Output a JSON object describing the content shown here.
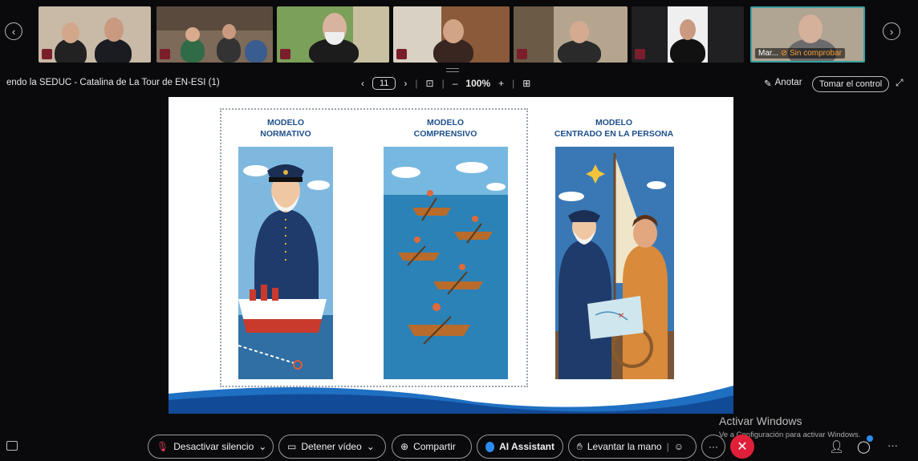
{
  "meeting": {
    "share_title": "endo la SEDUC - Catalina de La Tour de EN-ESI (1)",
    "page_current": "11",
    "zoom": "100%",
    "annotate_label": "Anotar",
    "take_control_label": "Tomar el control",
    "prev_page": "‹",
    "next_page": "›",
    "zoom_out": "–",
    "zoom_in": "+"
  },
  "participants": {
    "active_label": "Mar...",
    "active_status": "Sin comprobar"
  },
  "slide": {
    "col1": [
      "MODELO",
      "NORMATIVO"
    ],
    "col2": [
      "MODELO",
      "COMPRENSIVO"
    ],
    "col3": [
      "MODELO",
      "CENTRADO EN LA PERSONA"
    ]
  },
  "toolbar": {
    "mute_label": "Desactivar silencio",
    "video_label": "Detener vídeo",
    "share_label": "Compartir",
    "ai_label": "AI Assistant",
    "hand_label": "Levantar la mano",
    "more_label": "···"
  },
  "windows": {
    "activate_title": "Activar Windows",
    "activate_sub": "Ve a Configuración para activar Windows."
  },
  "icons": {
    "mic_muted": "mic-off-icon",
    "camera": "camera-icon",
    "share": "share-screen-icon",
    "ai": "ai-assistant-icon",
    "hand": "raise-hand-icon",
    "reaction": "reaction-icon",
    "leave": "leave-icon"
  }
}
